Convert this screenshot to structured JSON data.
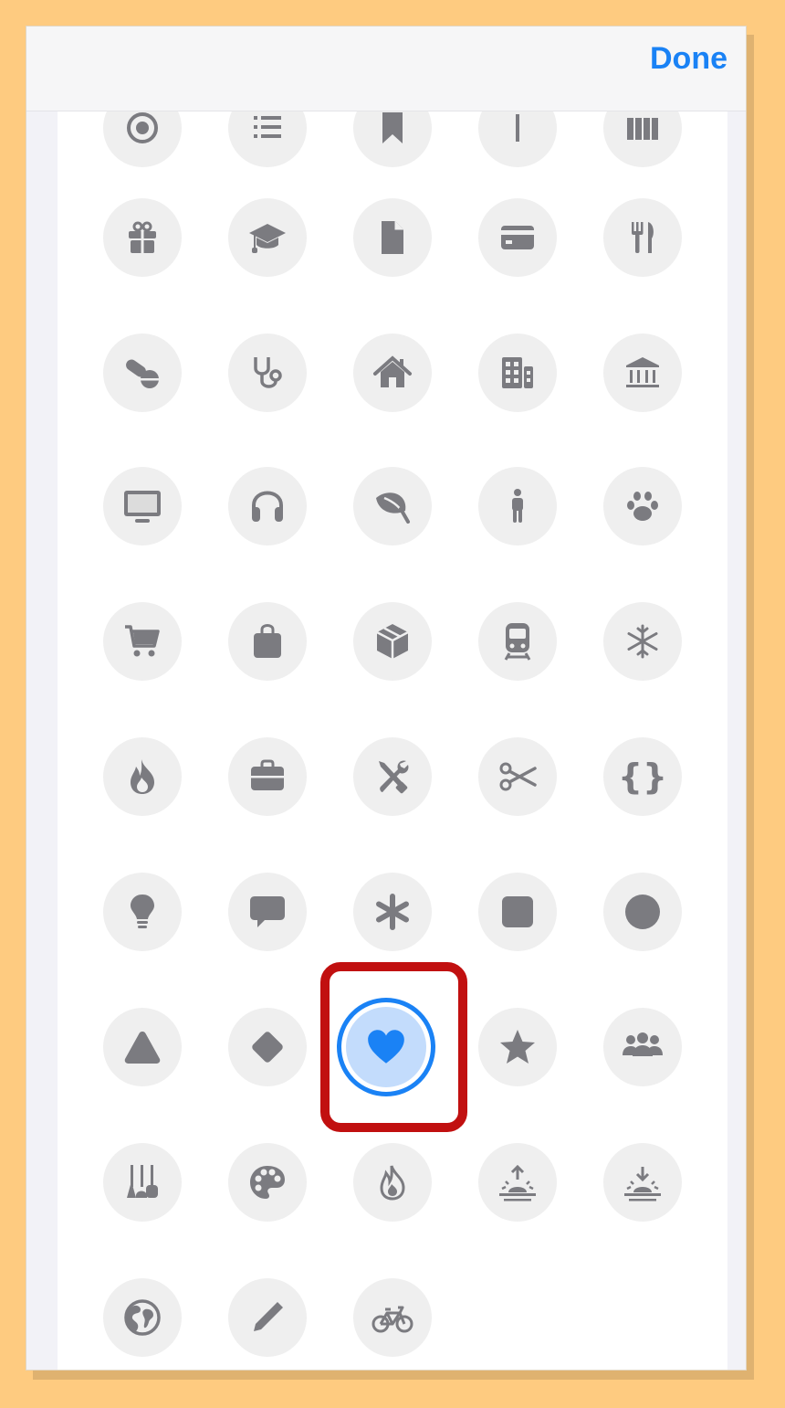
{
  "navbar": {
    "done_label": "Done"
  },
  "colors": {
    "accent": "#1a82f5",
    "icon": "#7b7b80",
    "cell_background": "#efefef",
    "selected_fill": "#c3dcfc",
    "highlight_border": "#c11010"
  },
  "icons": [
    "target-icon",
    "list-icon",
    "bookmark-icon",
    "pin-icon",
    "books-icon",
    "gift-icon",
    "graduation-cap-icon",
    "document-icon",
    "credit-card-icon",
    "fork-knife-icon",
    "pills-icon",
    "stethoscope-icon",
    "house-icon",
    "building-icon",
    "bank-icon",
    "desktop-icon",
    "headphones-icon",
    "leaf-icon",
    "person-icon",
    "paw-icon",
    "cart-icon",
    "bag-icon",
    "box-icon",
    "train-icon",
    "snowflake-icon",
    "flame-icon",
    "briefcase-icon",
    "tools-icon",
    "scissors-icon",
    "curly-braces-icon",
    "lightbulb-icon",
    "speech-bubble-icon",
    "asterisk-icon",
    "square-icon",
    "circle-icon",
    "triangle-icon",
    "diamond-icon",
    "heart-icon",
    "star-icon",
    "people-icon",
    "guitars-icon",
    "palette-icon",
    "flame-outline-icon",
    "sunrise-icon",
    "sunset-icon",
    "globe-icon",
    "pencil-icon",
    "bicycle-icon"
  ],
  "selected_icon": "heart-icon",
  "braces_glyph": "{}",
  "asterisk_glyph": "✱"
}
